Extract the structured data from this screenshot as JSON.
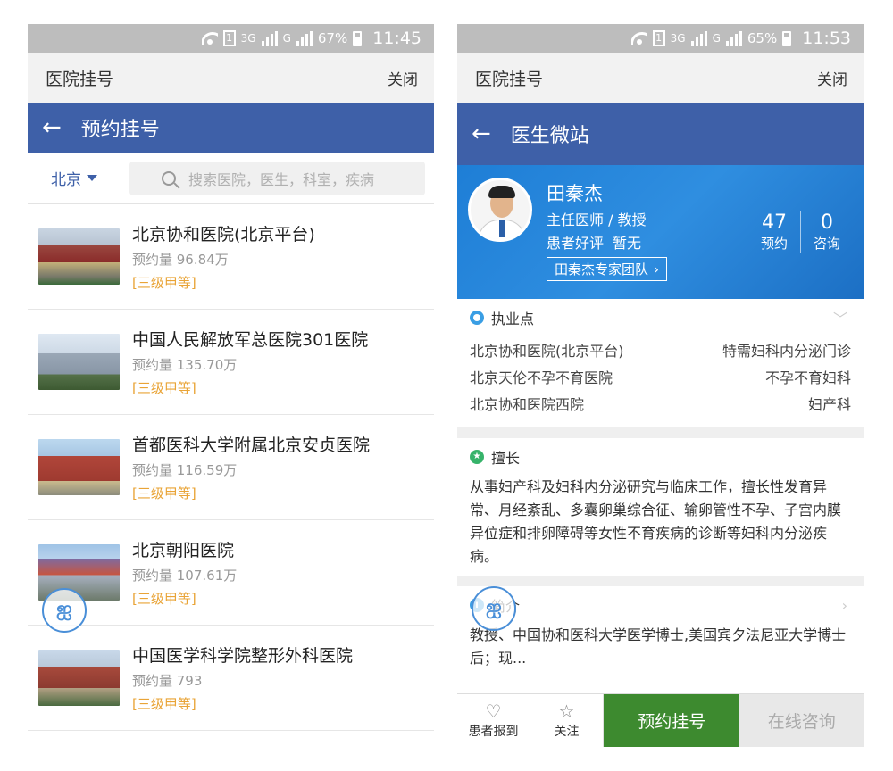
{
  "left": {
    "status": {
      "battery": "67%",
      "time": "11:45",
      "net1": "3G",
      "net2": "G"
    },
    "titlebar": {
      "title": "医院挂号",
      "close": "关闭"
    },
    "nav": {
      "title": "预约挂号"
    },
    "filter": {
      "city": "北京",
      "search_placeholder": "搜索医院，医生，科室，疾病"
    },
    "hospitals": [
      {
        "name": "北京协和医院(北京平台)",
        "count": "预约量 96.84万",
        "level": "[三级甲等]"
      },
      {
        "name": "中国人民解放军总医院301医院",
        "count": "预约量 135.70万",
        "level": "[三级甲等]"
      },
      {
        "name": "首都医科大学附属北京安贞医院",
        "count": "预约量 116.59万",
        "level": "[三级甲等]"
      },
      {
        "name": "北京朝阳医院",
        "count": "预约量 107.61万",
        "level": "[三级甲等]"
      },
      {
        "name": "中国医学科学院整形外科医院",
        "count": "预约量 793",
        "level": "[三级甲等]"
      }
    ]
  },
  "right": {
    "status": {
      "battery": "65%",
      "time": "11:53",
      "net1": "3G",
      "net2": "G"
    },
    "titlebar": {
      "title": "医院挂号",
      "close": "关闭"
    },
    "nav": {
      "title": "医生微站"
    },
    "doctor": {
      "name": "田秦杰",
      "title": "主任医师 / 教授",
      "rating_label": "患者好评",
      "rating_value": "暂无",
      "team": "田秦杰专家团队",
      "stats": [
        {
          "num": "47",
          "label": "预约"
        },
        {
          "num": "0",
          "label": "咨询"
        }
      ]
    },
    "practice": {
      "heading": "执业点",
      "rows": [
        {
          "hospital": "北京协和医院(北京平台)",
          "dept": "特需妇科内分泌门诊"
        },
        {
          "hospital": "北京天伦不孕不育医院",
          "dept": "不孕不育妇科"
        },
        {
          "hospital": "北京协和医院西院",
          "dept": "妇产科"
        }
      ]
    },
    "specialty": {
      "heading": "擅长",
      "text": "从事妇产科及妇科内分泌研究与临床工作，擅长性发育异常、月经紊乱、多囊卵巢综合征、输卵管性不孕、子宫内膜异位症和排卵障碍等女性不育疾病的诊断等妇科内分泌疾病。"
    },
    "intro": {
      "heading": "简介",
      "text": "教授、中国协和医科大学医学博士,美国宾夕法尼亚大学博士后；现..."
    },
    "bottom": {
      "report": "患者报到",
      "follow": "关注",
      "book": "预约挂号",
      "consult": "在线咨询"
    }
  }
}
